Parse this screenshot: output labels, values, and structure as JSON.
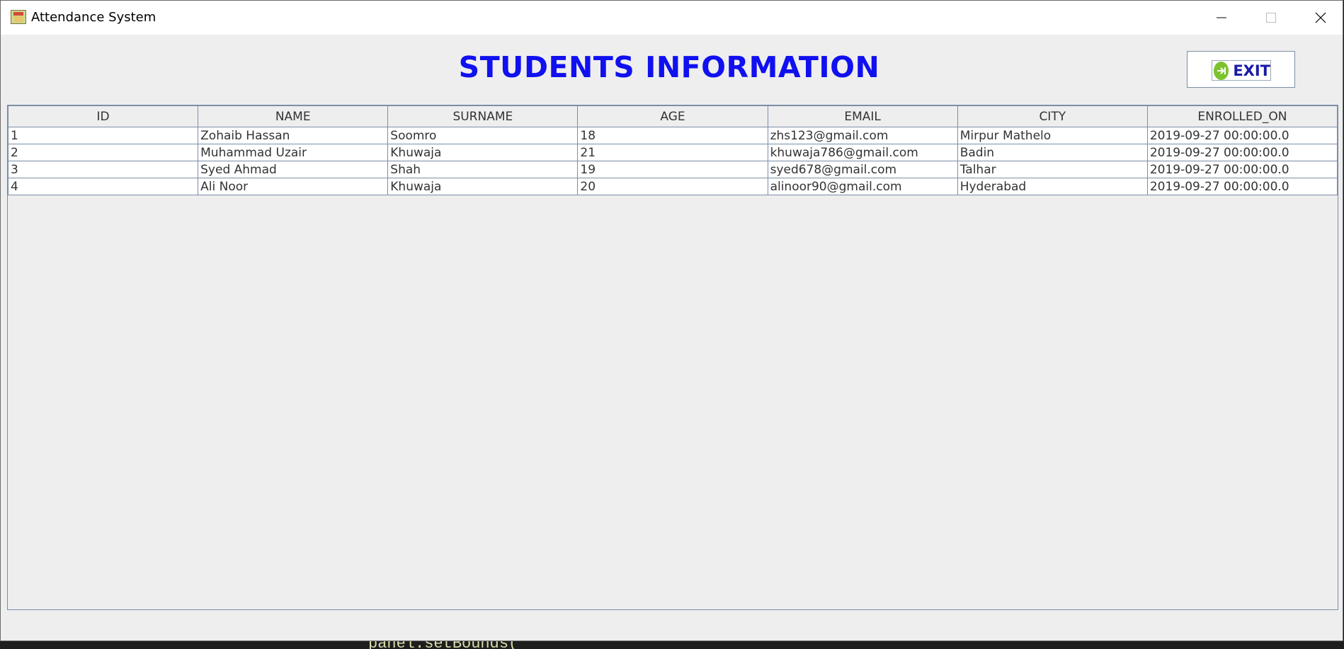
{
  "window": {
    "title": "Attendance System"
  },
  "page": {
    "heading": "STUDENTS INFORMATION",
    "exit_label": "EXIT"
  },
  "table": {
    "columns": [
      "ID",
      "NAME",
      "SURNAME",
      "AGE",
      "EMAIL",
      "CITY",
      "ENROLLED_ON"
    ],
    "rows": [
      [
        "1",
        "Zohaib Hassan",
        "Soomro",
        "18",
        "zhs123@gmail.com",
        "Mirpur Mathelo",
        "2019-09-27 00:00:00.0"
      ],
      [
        "2",
        "Muhammad Uzair",
        "Khuwaja",
        "21",
        "khuwaja786@gmail.com",
        "Badin",
        "2019-09-27 00:00:00.0"
      ],
      [
        "3",
        "Syed Ahmad",
        "Shah",
        "19",
        "syed678@gmail.com",
        "Talhar",
        "2019-09-27 00:00:00.0"
      ],
      [
        "4",
        "Ali Noor",
        "Khuwaja",
        "20",
        "alinoor90@gmail.com",
        "Hyderabad",
        "2019-09-27 00:00:00.0"
      ]
    ]
  },
  "colors": {
    "heading": "#1010f0",
    "exit_icon": "#7cc22d",
    "grid": "#7a8ea8"
  },
  "icons": {
    "app": "app-icon",
    "minimize": "minimize-icon",
    "maximize": "maximize-icon",
    "close": "close-icon",
    "exit": "exit-icon"
  }
}
